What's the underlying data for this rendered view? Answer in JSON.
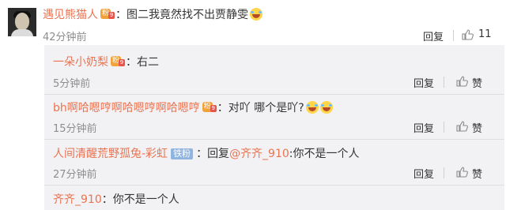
{
  "top_comment": {
    "username": "遇见熊猫人",
    "badge": {
      "icon": "user-level-badge",
      "text": "粉",
      "number": "9"
    },
    "colon": "：",
    "text": "图二我竟然找不出贾静雯",
    "emoji": "laughing-crying-emoji",
    "time": "42分钟前",
    "reply_label": "回复",
    "like_count": "11"
  },
  "replies": [
    {
      "username": "一朵小奶梨",
      "badge": {
        "icon": "user-level-badge",
        "text": "粉",
        "number": "9"
      },
      "colon": "：",
      "text": "右二",
      "time": "5分钟前",
      "reply_label": "回复",
      "like_label": "赞"
    },
    {
      "username": "bh啊哈嗯哼啊哈嗯哼啊哈嗯哼",
      "badge": {
        "icon": "user-level-badge",
        "text": "粉",
        "number": "9"
      },
      "colon": "：",
      "text": "对吖  哪个是吖?",
      "emoji": "laughing-crying-emoji",
      "time": "15分钟前",
      "reply_label": "回复",
      "like_label": "赞"
    },
    {
      "username": "人间清醒荒野孤兔-彩虹",
      "fan_badge": "铁粉",
      "colon": "：",
      "reply_word": "回复",
      "mention": "@齐齐_910",
      "text": ":你不是一个人",
      "time": "27分钟前",
      "reply_label": "回复",
      "like_label": "赞"
    },
    {
      "username": "齐齐_910",
      "colon": "：",
      "text": "你不是一个人"
    }
  ],
  "colors": {
    "username": "#eb7350",
    "time": "#8d8d8d",
    "reply_bg": "#f2f2f5"
  }
}
